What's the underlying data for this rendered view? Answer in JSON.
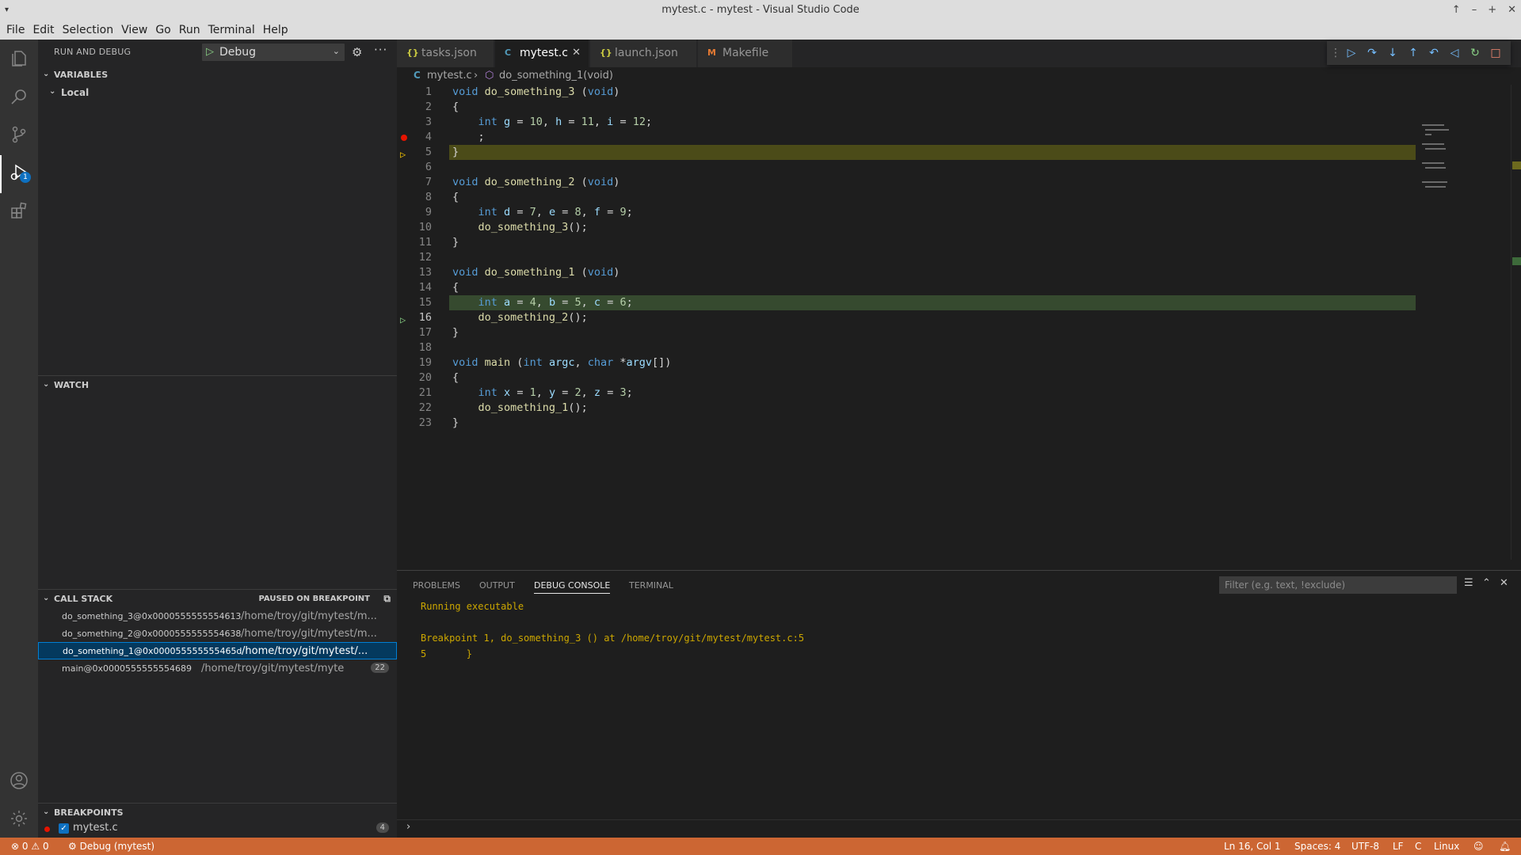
{
  "window": {
    "title": "mytest.c - mytest - Visual Studio Code"
  },
  "menu": [
    "File",
    "Edit",
    "Selection",
    "View",
    "Go",
    "Run",
    "Terminal",
    "Help"
  ],
  "activity": {
    "debug_badge": "1"
  },
  "sidebar": {
    "title": "RUN AND DEBUG",
    "config": "Debug",
    "variables": {
      "title": "VARIABLES",
      "scope": "Local"
    },
    "watch": {
      "title": "WATCH"
    },
    "callstack": {
      "title": "CALL STACK",
      "status": "PAUSED ON BREAKPOINT",
      "frames": [
        {
          "fn": "do_something_3@0x0000555555554613",
          "path": "/home/troy/git/mytest/m..."
        },
        {
          "fn": "do_something_2@0x0000555555554638",
          "path": "/home/troy/git/mytest/m..."
        },
        {
          "fn": "do_something_1@0x000055555555465d",
          "path": "/home/troy/git/mytest/..."
        },
        {
          "fn": "main@0x0000555555554689",
          "path": "/home/troy/git/mytest/mytest.c",
          "line": "22"
        }
      ]
    },
    "breakpoints": {
      "title": "BREAKPOINTS",
      "file": "mytest.c",
      "count": "4"
    }
  },
  "tabs": [
    {
      "icon": "{}",
      "label": "tasks.json"
    },
    {
      "icon": "C",
      "label": "mytest.c"
    },
    {
      "icon": "{}",
      "label": "launch.json"
    },
    {
      "icon": "M",
      "label": "Makefile"
    }
  ],
  "breadcrumb": {
    "file": "mytest.c",
    "symbol": "do_something_1(void)"
  },
  "code": {
    "line_numbers": [
      "1",
      "2",
      "3",
      "4",
      "5",
      "6",
      "7",
      "8",
      "9",
      "10",
      "11",
      "12",
      "13",
      "14",
      "15",
      "16",
      "17",
      "18",
      "19",
      "20",
      "21",
      "22",
      "23"
    ]
  },
  "panel": {
    "tabs": [
      "PROBLEMS",
      "OUTPUT",
      "DEBUG CONSOLE",
      "TERMINAL"
    ],
    "filter_placeholder": "Filter (e.g. text, !exclude)",
    "console": [
      "Running executable",
      "",
      "Breakpoint 1, do_something_3 () at /home/troy/git/mytest/mytest.c:5",
      "5\t}"
    ]
  },
  "status": {
    "errors": "0",
    "warnings": "0",
    "debug": "Debug (mytest)",
    "position": "Ln 16, Col 1",
    "spaces": "Spaces: 4",
    "encoding": "UTF-8",
    "eol": "LF",
    "language": "C",
    "platform": "Linux"
  },
  "colors": {
    "statusbar": "#cc6633",
    "breakpoint": "#e51400",
    "current_line": "#4b4b18",
    "focused_frame": "#364a2f"
  }
}
